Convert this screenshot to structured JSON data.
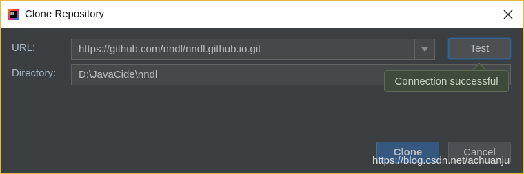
{
  "window": {
    "title": "Clone Repository"
  },
  "form": {
    "url_label": "URL:",
    "url_value": "https://github.com/nndl/nndl.github.io.git",
    "directory_label": "Directory:",
    "directory_value": "D:\\JavaCide\\nndl"
  },
  "buttons": {
    "test": "Test",
    "clone": "Clone",
    "cancel": "Cancel"
  },
  "tooltip": {
    "text": "Connection successful"
  },
  "watermark": {
    "text": "https://blog.csdn.net/achuanju"
  },
  "icons": {
    "app": "intellij-idea-icon",
    "close": "close-icon",
    "dropdown": "chevron-down-icon"
  },
  "colors": {
    "background": "#3c3f41",
    "primary_button": "#365880",
    "focus_border": "#3d6185",
    "tooltip_bg": "#3e4a3a"
  }
}
